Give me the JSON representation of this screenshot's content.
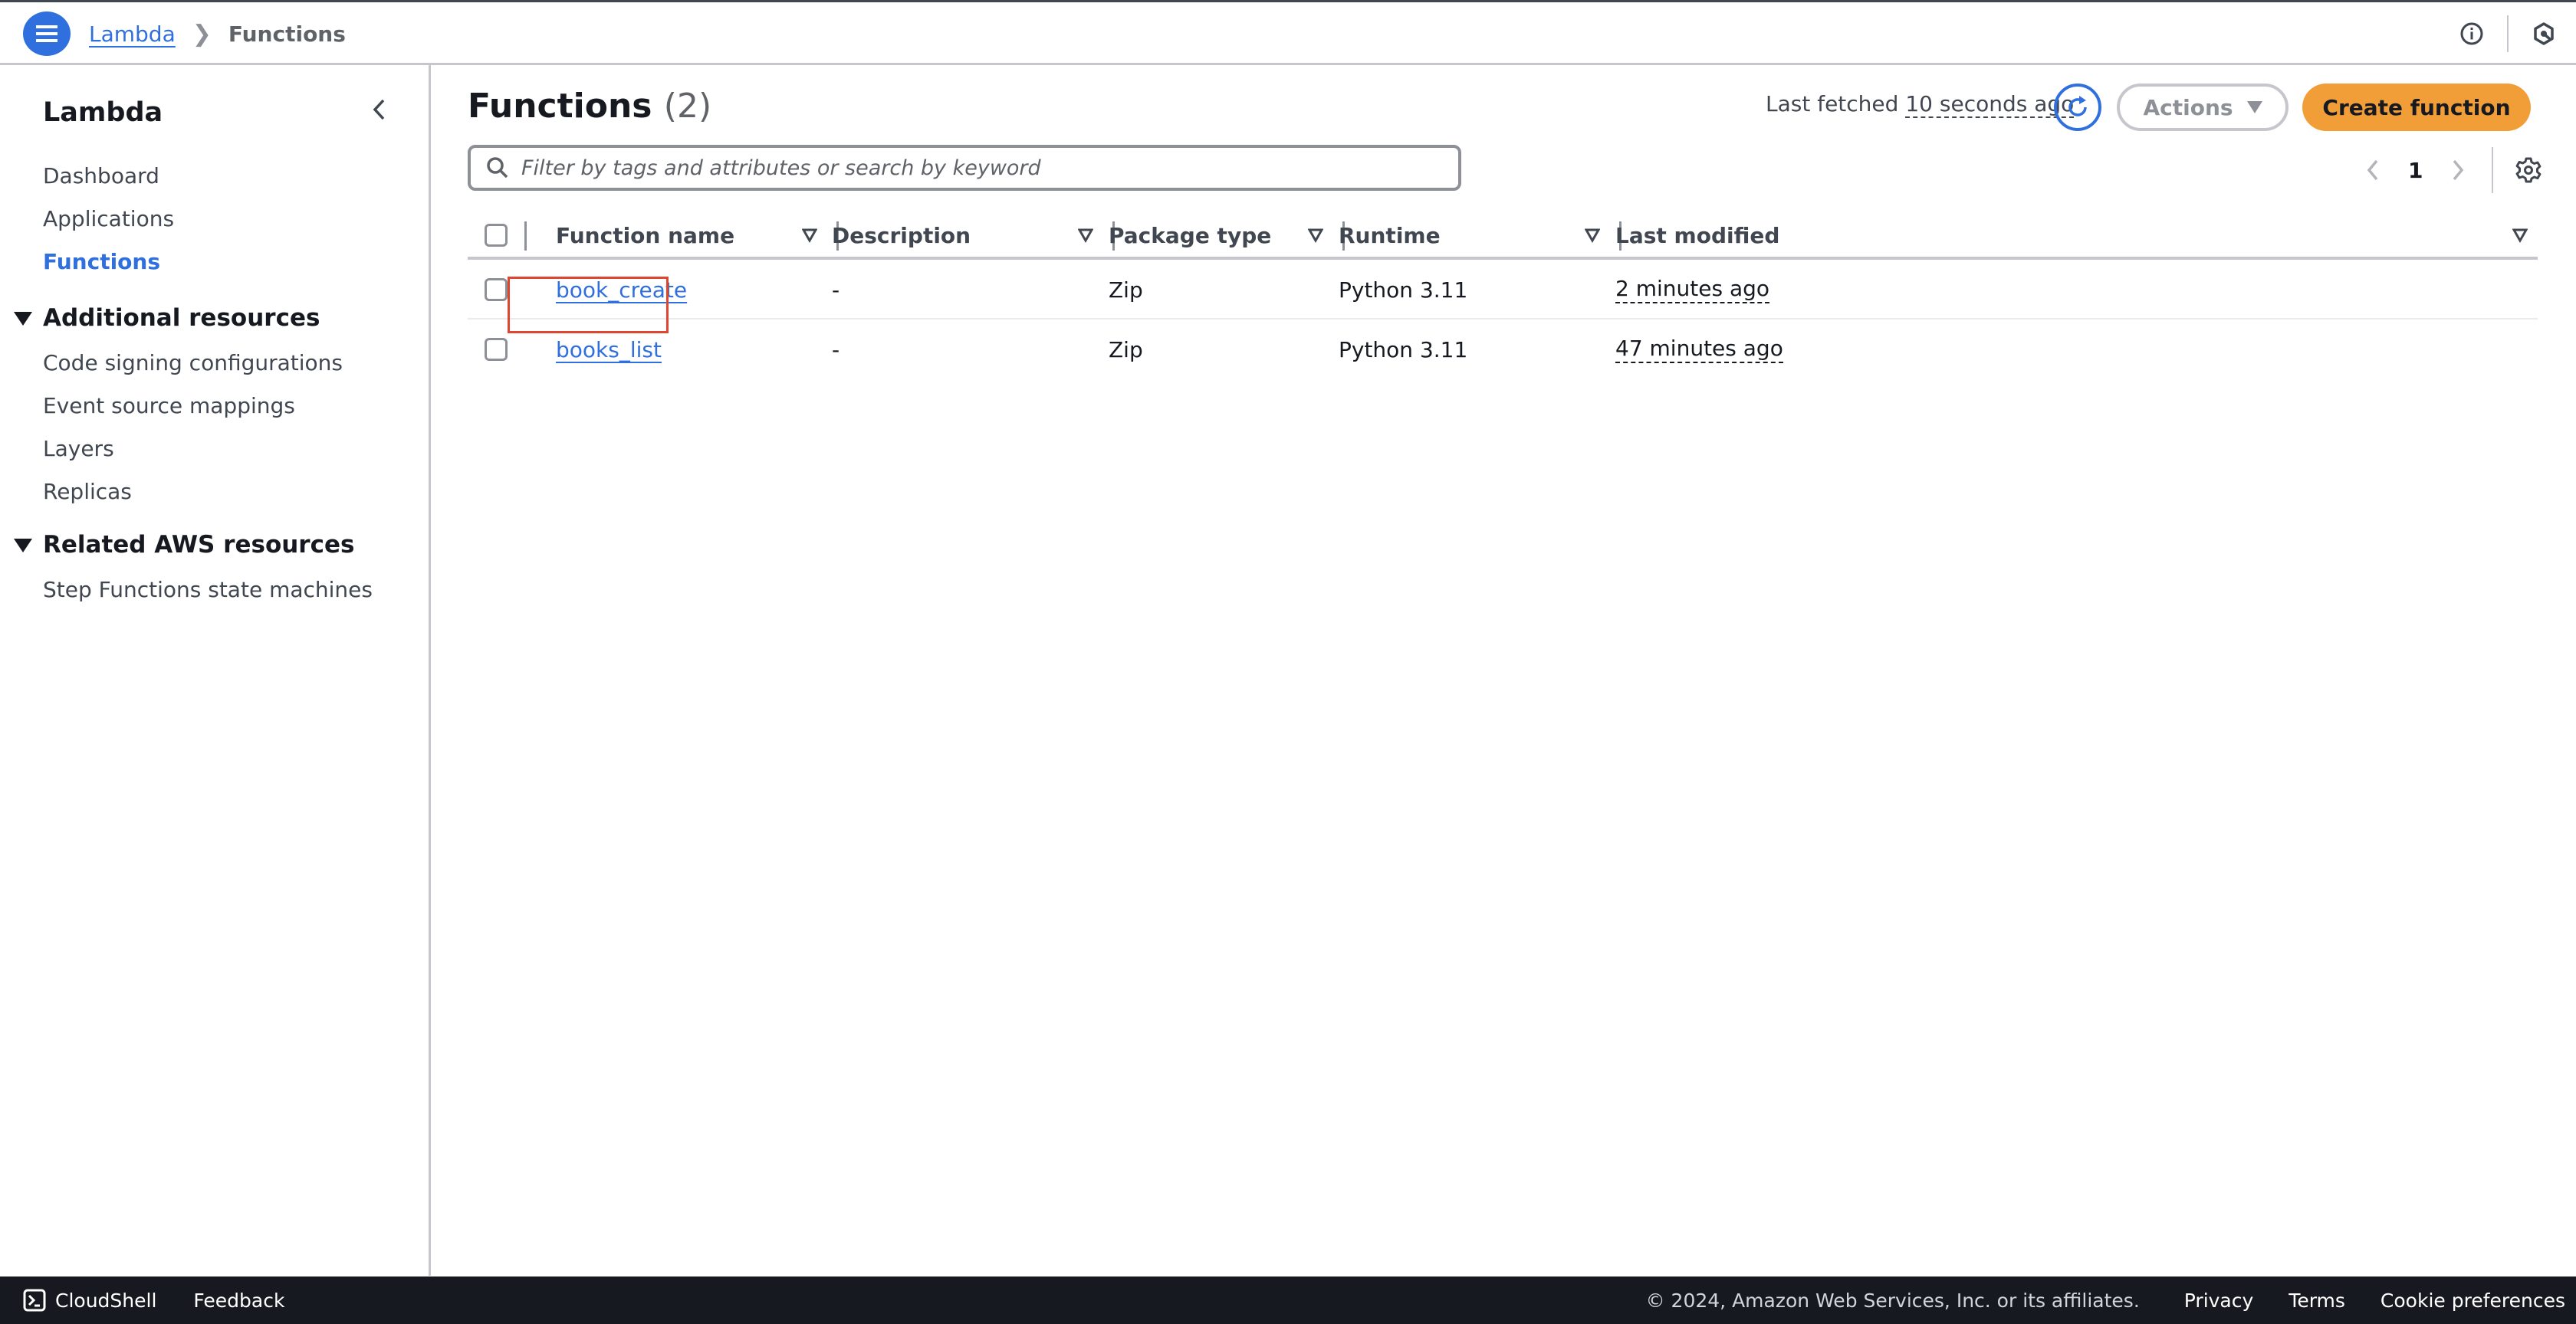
{
  "topbar": {
    "breadcrumb": [
      {
        "label": "Lambda"
      },
      {
        "label": "Functions"
      }
    ],
    "icons": [
      "menu-icon",
      "info-icon",
      "notifications-hex-icon"
    ]
  },
  "sidebar": {
    "title": "Lambda",
    "items": [
      {
        "label": "Dashboard",
        "active": false
      },
      {
        "label": "Applications",
        "active": false
      },
      {
        "label": "Functions",
        "active": true
      }
    ],
    "sections": [
      {
        "title": "Additional resources",
        "expanded": true,
        "items": [
          {
            "label": "Code signing configurations"
          },
          {
            "label": "Event source mappings"
          },
          {
            "label": "Layers"
          },
          {
            "label": "Replicas"
          }
        ]
      },
      {
        "title": "Related AWS resources",
        "expanded": true,
        "items": [
          {
            "label": "Step Functions state machines"
          }
        ]
      }
    ]
  },
  "main": {
    "title": "Functions",
    "count": "(2)",
    "last_fetched_label": "Last fetched",
    "last_fetched_value": "10 seconds ago",
    "actions_label": "Actions",
    "create_label": "Create function",
    "search": {
      "placeholder": "Filter by tags and attributes or search by keyword",
      "value": ""
    },
    "pagination": {
      "current_page": "1"
    },
    "accent_color": "#2f6fde",
    "primary_button_color": "#f19e39",
    "table": {
      "columns": [
        "Function name",
        "Description",
        "Package type",
        "Runtime",
        "Last modified"
      ],
      "rows": [
        {
          "name": "book_create",
          "description": "-",
          "package_type": "Zip",
          "runtime": "Python 3.11",
          "last_modified": "2 minutes ago",
          "highlighted": true
        },
        {
          "name": "books_list",
          "description": "-",
          "package_type": "Zip",
          "runtime": "Python 3.11",
          "last_modified": "47 minutes ago",
          "highlighted": false
        }
      ]
    }
  },
  "footer": {
    "cloudshell_label": "CloudShell",
    "feedback_label": "Feedback",
    "copyright": "© 2024, Amazon Web Services, Inc. or its affiliates.",
    "links": [
      "Privacy",
      "Terms",
      "Cookie preferences"
    ]
  }
}
